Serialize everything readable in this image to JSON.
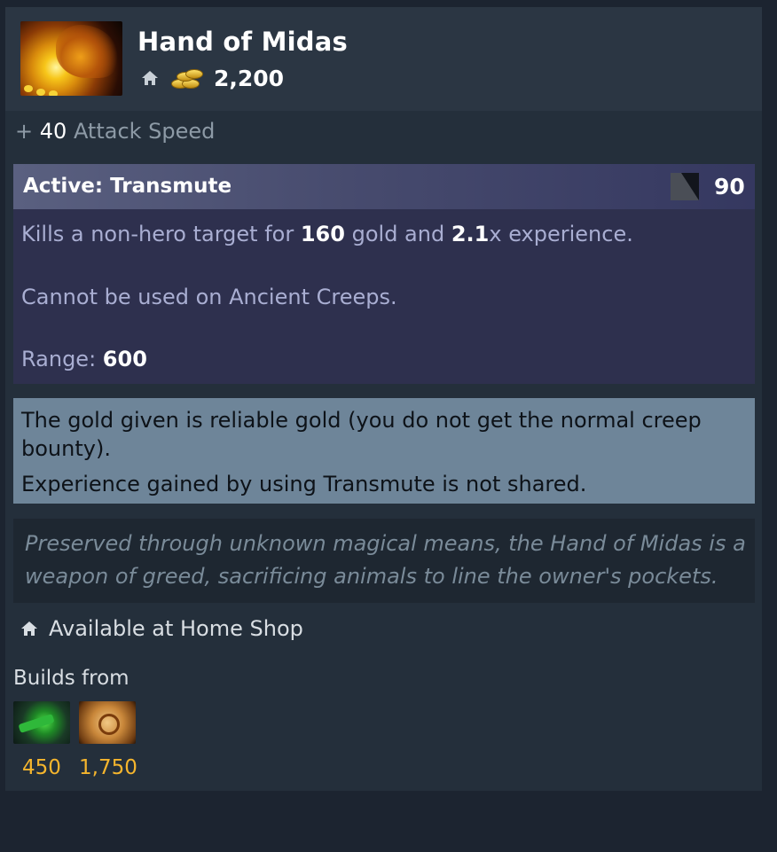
{
  "item": {
    "name": "Hand of Midas",
    "icon": "hand-of-midas-icon",
    "cost": "2,200"
  },
  "attribute": {
    "prefix": "+",
    "value": "40",
    "name": "Attack Speed"
  },
  "active": {
    "title": "Active: Transmute",
    "cooldown": "90",
    "desc_part1": "Kills a non-hero target for",
    "gold_value": "160",
    "desc_part2": "gold and",
    "xp_value": "2.1",
    "desc_part3": "x experience.",
    "restriction": "Cannot be used on Ancient Creeps.",
    "range_label": "Range:",
    "range_value": "600"
  },
  "notes": {
    "line1": "The gold given is reliable gold (you do not get the normal creep bounty).",
    "line2": "Experience gained by using Transmute is not shared."
  },
  "lore": "Preserved through unknown magical means, the Hand of Midas is a weapon of greed, sacrificing animals to line the owner's pockets.",
  "shop": {
    "label": "Available at Home Shop"
  },
  "builds": {
    "label": "Builds from",
    "components": [
      {
        "icon": "gloves-of-haste-icon",
        "cost": "450"
      },
      {
        "icon": "recipe-scroll-icon",
        "cost": "1,750"
      }
    ]
  },
  "colors": {
    "background": "#1c2430",
    "panel": "#242f3b",
    "active_box": "#2e304e",
    "note_box": "#6e8599",
    "gold_text": "#f5b52d"
  }
}
